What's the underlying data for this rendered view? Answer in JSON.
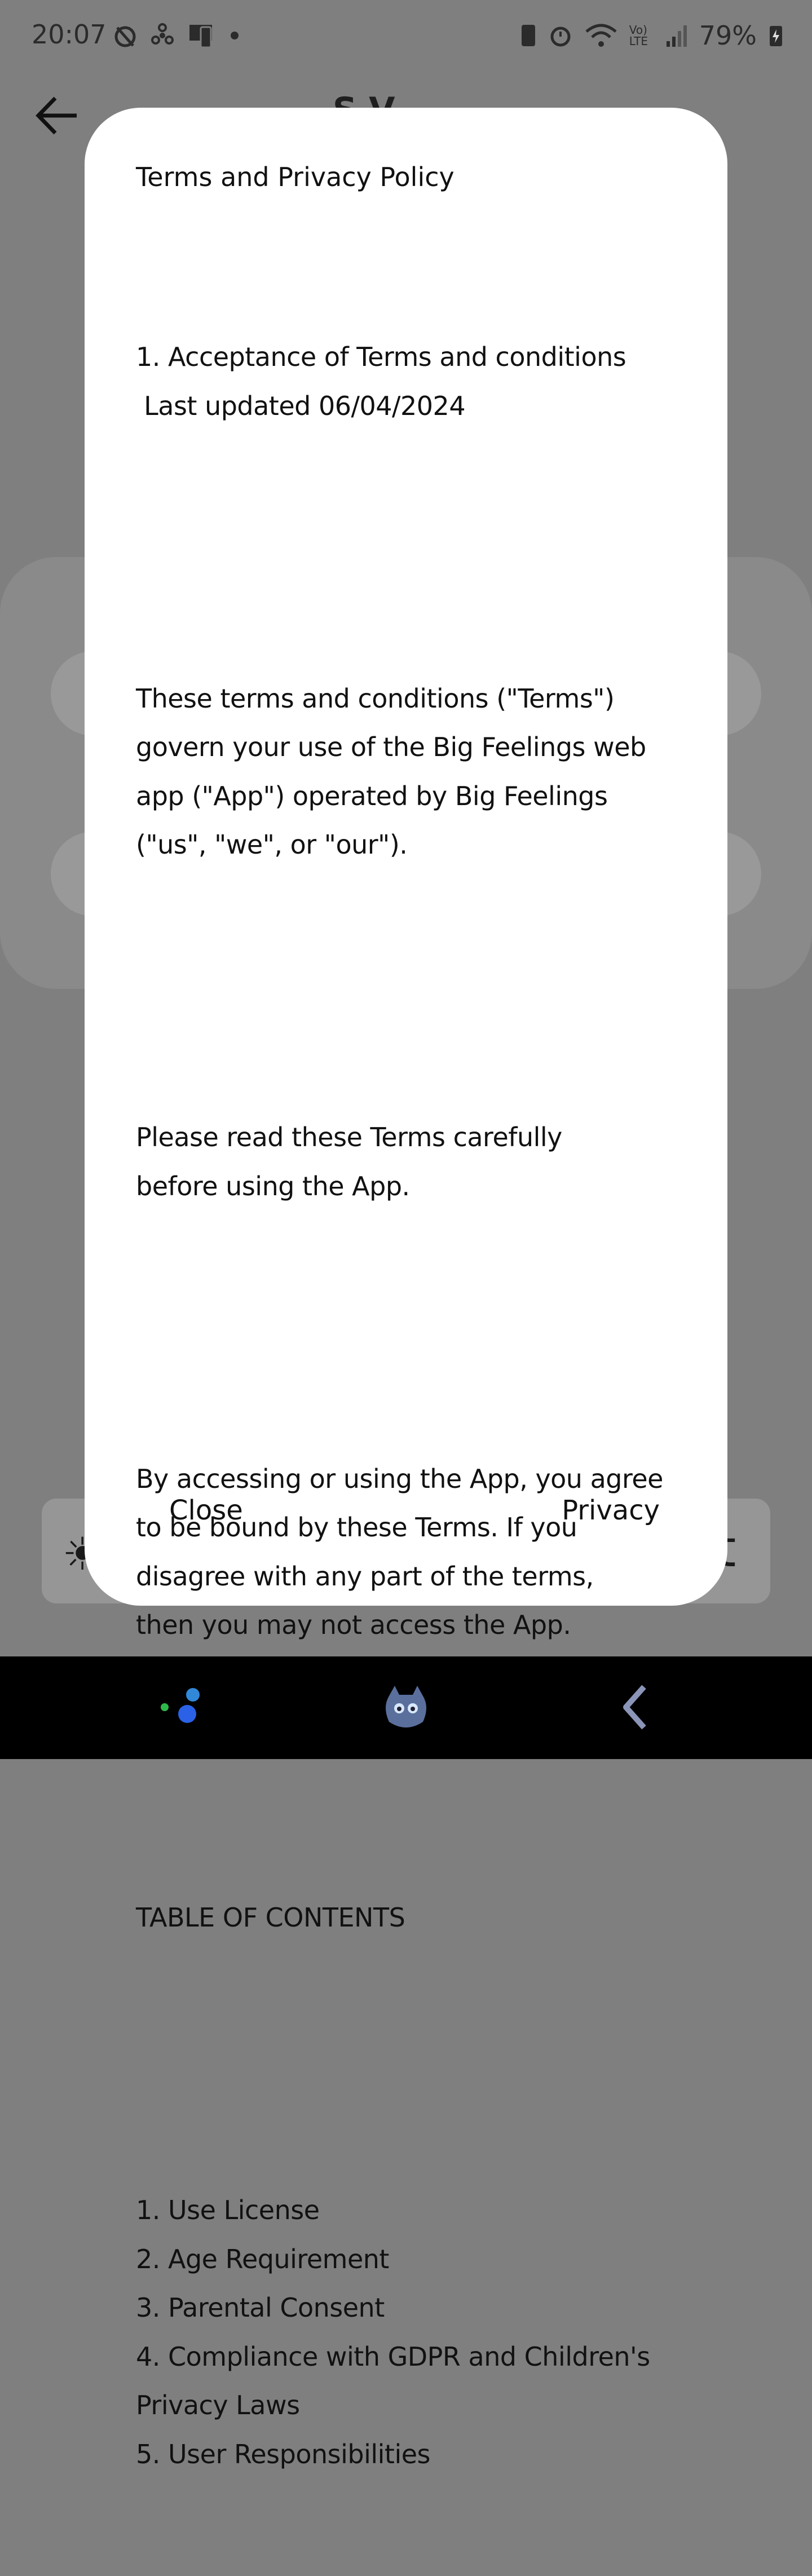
{
  "status_bar": {
    "time": "20:07",
    "battery": "79%",
    "network": "Vo) LTE"
  },
  "background": {
    "title": "S     V"
  },
  "dialog": {
    "title": "Terms and Privacy Policy",
    "paragraphs": [
      "1. Acceptance of Terms and conditions\n Last updated 06/04/2024",
      "",
      "These terms and conditions (\"Terms\")\ngovern your use of the Big Feelings web\napp (\"App\") operated by Big Feelings\n(\"us\", \"we\", or \"our\").",
      "",
      "Please read these Terms carefully\nbefore using the App.",
      "",
      "By accessing or using the App, you agree\nto be bound by these Terms. If you\ndisagree with any part of the terms,\nthen you may not access the App.",
      "",
      "TABLE OF CONTENTS",
      "",
      "1. Use License\n2. Age Requirement\n3. Parental Consent\n4. Compliance with GDPR and Children's\nPrivacy Laws\n5. User Responsibilities"
    ],
    "close_label": "Close",
    "privacy_label": "Privacy"
  },
  "icons": {
    "back": "arrow-left-icon",
    "nav": [
      "recents-icon",
      "home-icon",
      "back-icon"
    ]
  }
}
